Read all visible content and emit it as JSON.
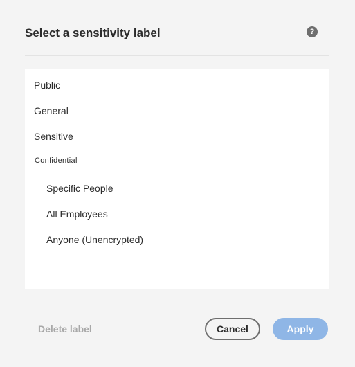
{
  "dialog": {
    "title": "Select a sensitivity label",
    "help_icon": "?"
  },
  "labels": {
    "items": [
      {
        "label": "Public"
      },
      {
        "label": "General"
      },
      {
        "label": "Sensitive"
      }
    ],
    "group": {
      "label": "Confidential",
      "children": [
        {
          "label": "Specific People"
        },
        {
          "label": "All Employees"
        },
        {
          "label": "Anyone (Unencrypted)"
        }
      ]
    }
  },
  "footer": {
    "delete_label": "Delete label",
    "cancel_label": "Cancel",
    "apply_label": "Apply"
  },
  "colors": {
    "apply_button": "#8fb6e6",
    "disabled_text": "#a8a8a8"
  }
}
